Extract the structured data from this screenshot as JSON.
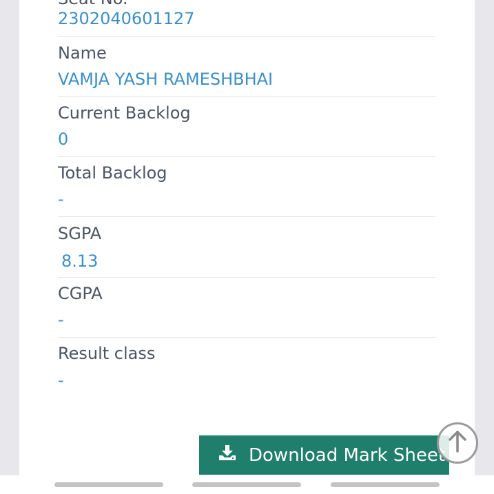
{
  "fields": [
    {
      "label": "Seat No.",
      "value": "2302040601127"
    },
    {
      "label": "Name",
      "value": "VAMJA YASH RAMESHBHAI"
    },
    {
      "label": "Current Backlog",
      "value": "0"
    },
    {
      "label": "Total Backlog",
      "value": "-"
    },
    {
      "label": "SGPA",
      "value": "8.13"
    },
    {
      "label": "CGPA",
      "value": "-"
    },
    {
      "label": "Result class",
      "value": "-"
    }
  ],
  "download": {
    "label": "Download Mark Sheet",
    "icon": "download-icon"
  },
  "scroll_top": {
    "icon": "arrow-up-circle-icon"
  },
  "colors": {
    "accent": "#1f7f6c",
    "value": "#3d8fc6",
    "label": "#4b5563"
  }
}
